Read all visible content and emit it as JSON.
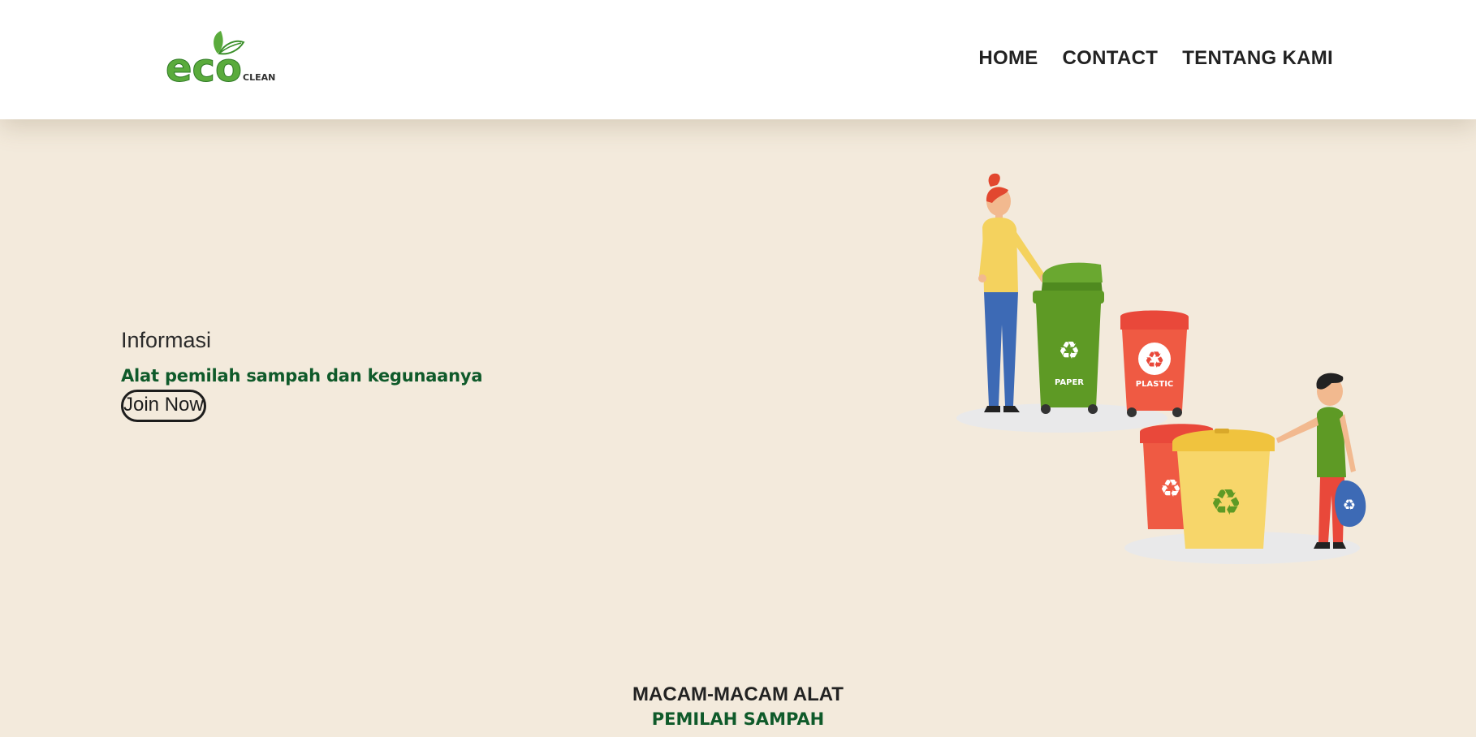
{
  "header": {
    "logo": {
      "main": "eco",
      "secondary": "CLEAN"
    },
    "nav": [
      {
        "label": "HOME"
      },
      {
        "label": "CONTACT"
      },
      {
        "label": "TENTANG KAMI"
      }
    ]
  },
  "hero": {
    "title": "Informasi",
    "subtitle": "Alat pemilah sampah dan kegunaanya",
    "button_label": "Join Now",
    "illustration": {
      "bin_labels": [
        "PAPER",
        "PLASTIC"
      ]
    }
  },
  "section": {
    "title": "MACAM-MACAM ALAT",
    "subtitle": "PEMILAH SAMPAH"
  },
  "colors": {
    "page_background": "#f3eadc",
    "brand_green": "#0f5a2a",
    "logo_green": "#5aab3c",
    "bin_green": "#5e9a25",
    "bin_red": "#e9483a",
    "bin_yellow": "#f7d66a"
  }
}
